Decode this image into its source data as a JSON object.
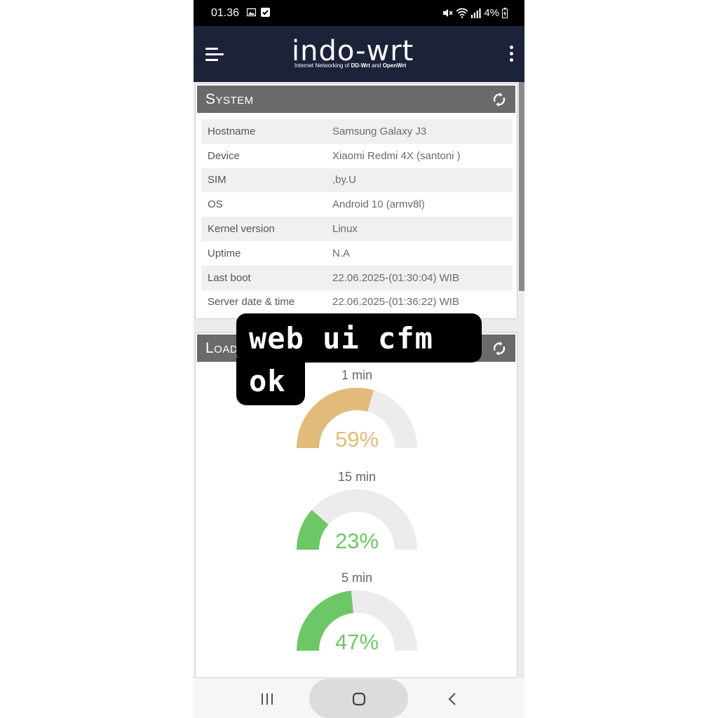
{
  "status_bar": {
    "time": "01.36",
    "battery": "4%",
    "icons": [
      "gallery-icon",
      "check-box-icon",
      "mute-icon",
      "wifi-icon",
      "signal-icon",
      "battery-charging-icon"
    ]
  },
  "header": {
    "logo_main": "indo-wrt",
    "logo_sub_prefix": "Internet Networking of ",
    "logo_sub_ddwrt": "DD-Wrt",
    "logo_sub_and": " and ",
    "logo_sub_openwrt": "OpenWrt",
    "menu_icon": "hamburger-menu-icon",
    "more_icon": "more-vertical-icon"
  },
  "system_panel": {
    "title": "System",
    "refresh_icon": "refresh-icon",
    "rows": [
      {
        "key": "Hostname",
        "value": "Samsung Galaxy J3"
      },
      {
        "key": "Device",
        "value": "Xiaomi Redmi 4X (santoni )"
      },
      {
        "key": "SIM",
        "value": ",by.U"
      },
      {
        "key": "OS",
        "value": "Android 10 (armv8l)"
      },
      {
        "key": "Kernel version",
        "value": "Linux"
      },
      {
        "key": "Uptime",
        "value": "N.A"
      },
      {
        "key": "Last boot",
        "value": "22.06.2025-(01:30:04) WIB"
      },
      {
        "key": "Server date & time",
        "value": "22.06.2025-(01:36:22) WIB"
      }
    ]
  },
  "load_panel": {
    "title": "Load",
    "refresh_icon": "refresh-icon",
    "gauges": [
      {
        "label": "1 min",
        "value_text": "59%",
        "fraction": 0.59,
        "color": "#e2bb7c"
      },
      {
        "label": "15 min",
        "value_text": "23%",
        "fraction": 0.23,
        "color": "#6dc766"
      },
      {
        "label": "5 min",
        "value_text": "47%",
        "fraction": 0.47,
        "color": "#6dc766"
      }
    ],
    "track_color": "#ececec"
  },
  "sticker": {
    "line1": "web ui cfm",
    "line2": "ok"
  },
  "nav_bar": {
    "recents_icon": "recents-icon",
    "home_icon": "home-icon",
    "back_icon": "back-icon"
  }
}
